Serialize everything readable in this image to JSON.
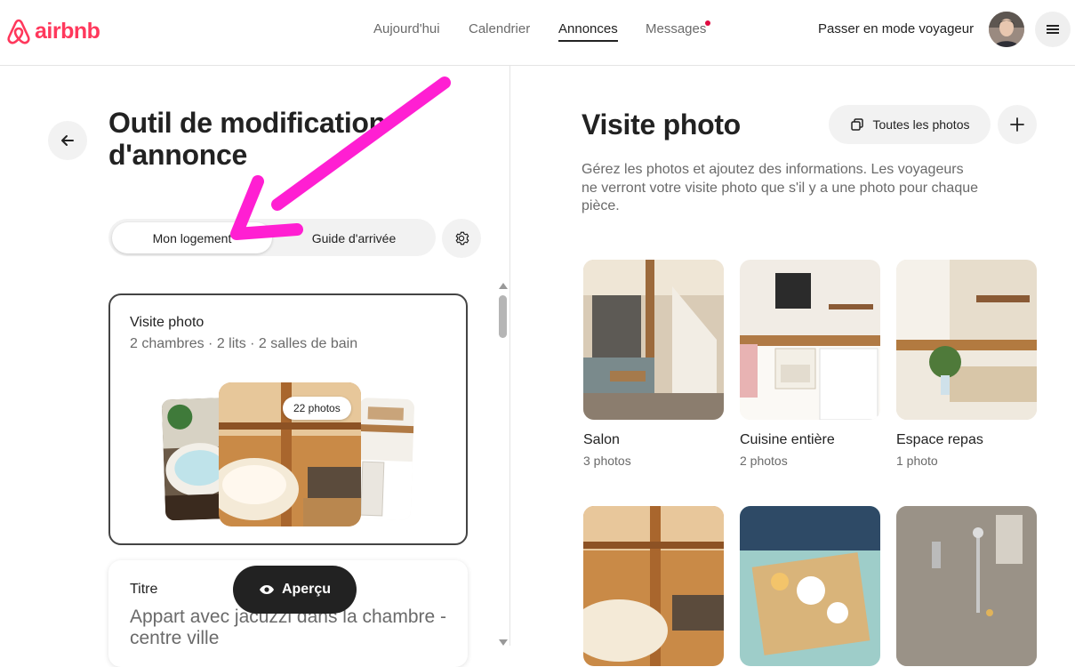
{
  "brand": {
    "name": "airbnb",
    "color": "#ff385c"
  },
  "nav": {
    "items": [
      {
        "label": "Aujourd'hui",
        "active": false
      },
      {
        "label": "Calendrier",
        "active": false
      },
      {
        "label": "Annonces",
        "active": true
      },
      {
        "label": "Messages",
        "active": false,
        "notification": true
      }
    ],
    "host_switch": "Passer en mode voyageur"
  },
  "left": {
    "title": "Outil de modification d'annonce",
    "tabs": [
      "Mon logement",
      "Guide d'arrivée"
    ],
    "selected_tab": "Mon logement",
    "card_photo_tour": {
      "title": "Visite photo",
      "summary": "2 chambres · 2 lits · 2 salles de bain",
      "badge": "22 photos"
    },
    "card_title": {
      "label": "Titre",
      "value": "Appart avec jacuzzi dans la chambre - centre ville"
    },
    "preview_button": "Aperçu"
  },
  "right": {
    "title": "Visite photo",
    "all_photos_button": "Toutes les photos",
    "description": "Gérez les photos et ajoutez des informations. Les voyageurs ne verront votre visite photo que s'il y a une photo pour chaque pièce.",
    "rooms": [
      {
        "name": "Salon",
        "count": "3 photos"
      },
      {
        "name": "Cuisine entière",
        "count": "2 photos"
      },
      {
        "name": "Espace repas",
        "count": "1 photo"
      },
      {
        "name": "",
        "count": ""
      },
      {
        "name": "",
        "count": ""
      },
      {
        "name": "",
        "count": ""
      }
    ]
  },
  "annotation": {
    "color": "#ff1fd2",
    "icon": "arrow-annotation"
  },
  "icons": [
    "airbnb-logo-icon",
    "back-arrow-icon",
    "gear-icon",
    "menu-icon",
    "eye-icon",
    "copy-icon",
    "plus-icon"
  ]
}
